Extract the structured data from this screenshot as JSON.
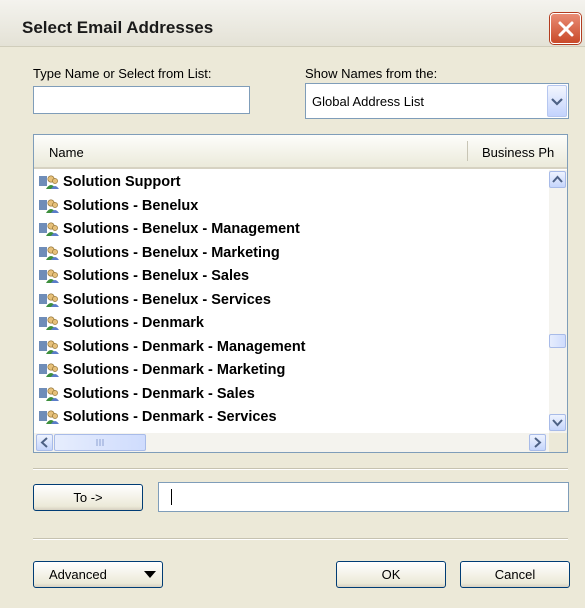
{
  "window": {
    "title": "Select Email Addresses",
    "close_icon": "close-icon"
  },
  "search": {
    "label": "Type Name or Select from List:",
    "value": ""
  },
  "address_book": {
    "label": "Show Names from the:",
    "selected": "Global Address List"
  },
  "list": {
    "columns": [
      "Name",
      "Business Ph"
    ],
    "items": [
      "Solution Support",
      "Solutions - Benelux",
      "Solutions - Benelux - Management",
      "Solutions - Benelux - Marketing",
      "Solutions - Benelux - Sales",
      "Solutions - Benelux - Services",
      "Solutions - Denmark",
      "Solutions - Denmark - Management",
      "Solutions - Denmark - Marketing",
      "Solutions - Denmark - Sales",
      "Solutions - Denmark - Services"
    ],
    "item_icon": "distribution-list-icon"
  },
  "recipients": {
    "to_button": "To ->",
    "to_value": ""
  },
  "footer": {
    "advanced_button": "Advanced",
    "ok_button": "OK",
    "cancel_button": "Cancel"
  }
}
